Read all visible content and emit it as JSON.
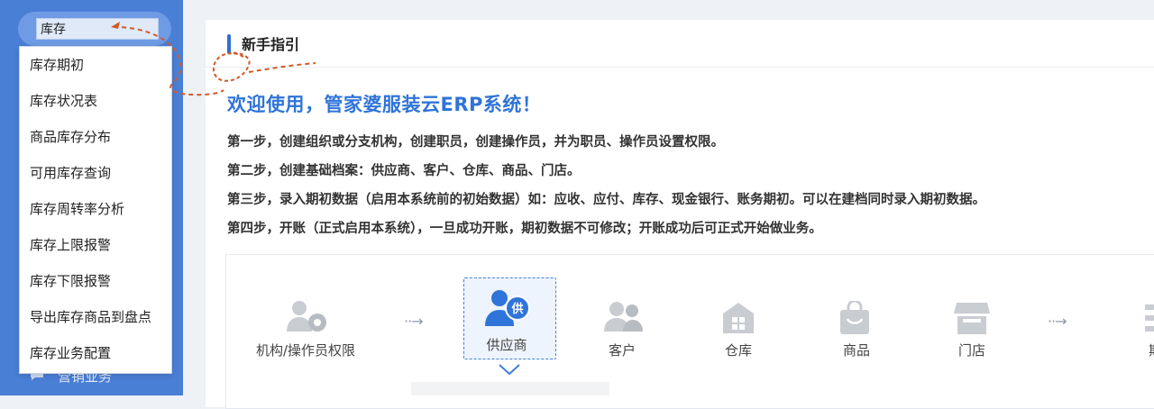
{
  "search": {
    "value": "库存"
  },
  "dropdown_items": [
    "库存期初",
    "库存状况表",
    "商品库存分布",
    "可用库存查询",
    "库存周转率分析",
    "库存上限报警",
    "库存下限报警",
    "导出库存商品到盘点",
    "库存业务配置"
  ],
  "sidebar_bottom_label": "营销业务",
  "guide": {
    "title": "新手指引",
    "welcome": "欢迎使用，管家婆服装云ERP系统！",
    "steps": [
      "第一步，创建组织或分支机构，创建职员，创建操作员，并为职员、操作员设置权限。",
      "第二步，创建基础档案：供应商、客户、仓库、商品、门店。",
      "第三步，录入期初数据（启用本系统前的初始数据）如：应收、应付、库存、现金银行、账务期初。可以在建档同时录入期初数据。",
      "第四步，开账（正式启用本系统），一旦成功开账，期初数据不可修改；开账成功后可正式开始做业务。"
    ]
  },
  "flow": {
    "items": [
      {
        "label": "机构/操作员权限",
        "icon": "user-gear-icon"
      },
      {
        "label": "供应商",
        "icon": "supplier-icon",
        "badge": "供"
      },
      {
        "label": "客户",
        "icon": "customers-icon"
      },
      {
        "label": "仓库",
        "icon": "warehouse-icon"
      },
      {
        "label": "商品",
        "icon": "product-bag-icon"
      },
      {
        "label": "门店",
        "icon": "store-icon"
      },
      {
        "label": "期",
        "icon": "opening-icon"
      }
    ],
    "arrow": "··→",
    "selected_color": "#3f80dc"
  },
  "colors": {
    "sidebar": "#4a7fd6",
    "accent": "#2f74d8",
    "annotation": "#d2592a"
  }
}
